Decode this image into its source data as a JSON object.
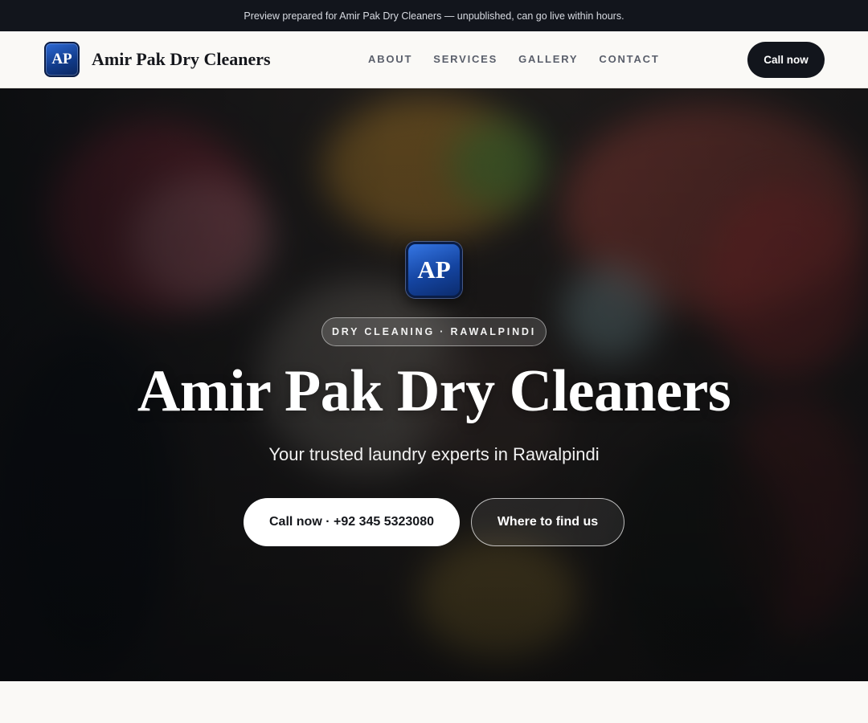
{
  "topbar": {
    "notice": "Preview prepared for Amir Pak Dry Cleaners — unpublished, can go live within hours."
  },
  "brand": {
    "logo_initials": "AP",
    "name": "Amir Pak Dry Cleaners"
  },
  "nav": {
    "items": [
      "ABOUT",
      "SERVICES",
      "GALLERY",
      "CONTACT"
    ]
  },
  "header": {
    "cta_label": "Call now"
  },
  "hero": {
    "logo_initials": "AP",
    "tag": "DRY CLEANING · RAWALPINDI",
    "title": "Amir Pak Dry Cleaners",
    "subtitle": "Your trusted laundry experts in Rawalpindi",
    "primary_button": "Call now · +92 345 5323080",
    "secondary_button": "Where to find us"
  },
  "colors": {
    "topbar_bg": "#12151c",
    "header_bg": "#faf9f6",
    "cta_bg": "#12151c",
    "logo_blue": "#1444a0",
    "hero_button_bg": "#ffffff"
  }
}
